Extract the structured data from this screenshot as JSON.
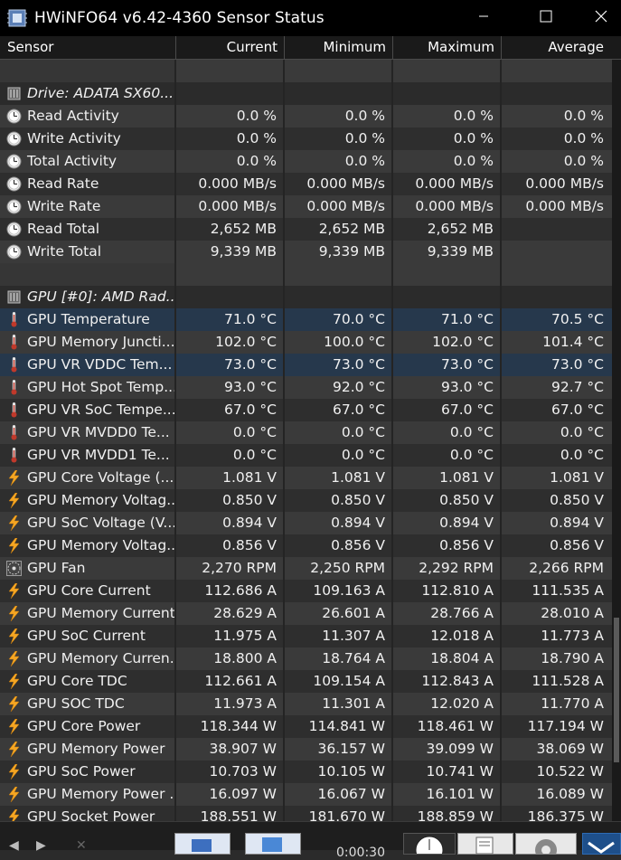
{
  "window": {
    "title": "HWiNFO64 v6.42-4360 Sensor Status",
    "minimize_glyph": "—",
    "maximize_glyph": "☐",
    "close_glyph": "✕"
  },
  "columns": {
    "sensor": "Sensor",
    "current": "Current",
    "minimum": "Minimum",
    "maximum": "Maximum",
    "average": "Average"
  },
  "rows": [
    {
      "type": "blank"
    },
    {
      "type": "group",
      "icon": "chip-icon",
      "name": "Drive: ADATA SX60..."
    },
    {
      "type": "data",
      "icon": "clock-icon",
      "name": "Read Activity",
      "current": "0.0 %",
      "min": "0.0 %",
      "max": "0.0 %",
      "avg": "0.0 %"
    },
    {
      "type": "data",
      "icon": "clock-icon",
      "name": "Write Activity",
      "current": "0.0 %",
      "min": "0.0 %",
      "max": "0.0 %",
      "avg": "0.0 %"
    },
    {
      "type": "data",
      "icon": "clock-icon",
      "name": "Total Activity",
      "current": "0.0 %",
      "min": "0.0 %",
      "max": "0.0 %",
      "avg": "0.0 %"
    },
    {
      "type": "data",
      "icon": "clock-icon",
      "name": "Read Rate",
      "current": "0.000 MB/s",
      "min": "0.000 MB/s",
      "max": "0.000 MB/s",
      "avg": "0.000 MB/s"
    },
    {
      "type": "data",
      "icon": "clock-icon",
      "name": "Write Rate",
      "current": "0.000 MB/s",
      "min": "0.000 MB/s",
      "max": "0.000 MB/s",
      "avg": "0.000 MB/s"
    },
    {
      "type": "data",
      "icon": "clock-icon",
      "name": "Read Total",
      "current": "2,652 MB",
      "min": "2,652 MB",
      "max": "2,652 MB",
      "avg": ""
    },
    {
      "type": "data",
      "icon": "clock-icon",
      "name": "Write Total",
      "current": "9,339 MB",
      "min": "9,339 MB",
      "max": "9,339 MB",
      "avg": ""
    },
    {
      "type": "blank"
    },
    {
      "type": "group",
      "icon": "chip-icon",
      "name": "GPU [#0]: AMD Rad..."
    },
    {
      "type": "data",
      "icon": "thermometer-icon",
      "name": "GPU Temperature",
      "current": "71.0 °C",
      "min": "70.0 °C",
      "max": "71.0 °C",
      "avg": "70.5 °C",
      "highlight": true
    },
    {
      "type": "data",
      "icon": "thermometer-icon",
      "name": "GPU Memory Juncti...",
      "current": "102.0 °C",
      "min": "100.0 °C",
      "max": "102.0 °C",
      "avg": "101.4 °C"
    },
    {
      "type": "data",
      "icon": "thermometer-icon",
      "name": "GPU VR VDDC Tem...",
      "current": "73.0 °C",
      "min": "73.0 °C",
      "max": "73.0 °C",
      "avg": "73.0 °C",
      "highlight": true
    },
    {
      "type": "data",
      "icon": "thermometer-icon",
      "name": "GPU Hot Spot Temp...",
      "current": "93.0 °C",
      "min": "92.0 °C",
      "max": "93.0 °C",
      "avg": "92.7 °C"
    },
    {
      "type": "data",
      "icon": "thermometer-icon",
      "name": "GPU VR SoC Tempe...",
      "current": "67.0 °C",
      "min": "67.0 °C",
      "max": "67.0 °C",
      "avg": "67.0 °C"
    },
    {
      "type": "data",
      "icon": "thermometer-icon",
      "name": "GPU VR MVDD0 Te...",
      "current": "0.0 °C",
      "min": "0.0 °C",
      "max": "0.0 °C",
      "avg": "0.0 °C"
    },
    {
      "type": "data",
      "icon": "thermometer-icon",
      "name": "GPU VR MVDD1 Te...",
      "current": "0.0 °C",
      "min": "0.0 °C",
      "max": "0.0 °C",
      "avg": "0.0 °C"
    },
    {
      "type": "data",
      "icon": "lightning-icon",
      "name": "GPU Core Voltage (...",
      "current": "1.081 V",
      "min": "1.081 V",
      "max": "1.081 V",
      "avg": "1.081 V"
    },
    {
      "type": "data",
      "icon": "lightning-icon",
      "name": "GPU Memory Voltag...",
      "current": "0.850 V",
      "min": "0.850 V",
      "max": "0.850 V",
      "avg": "0.850 V"
    },
    {
      "type": "data",
      "icon": "lightning-icon",
      "name": "GPU SoC Voltage (V...",
      "current": "0.894 V",
      "min": "0.894 V",
      "max": "0.894 V",
      "avg": "0.894 V"
    },
    {
      "type": "data",
      "icon": "lightning-icon",
      "name": "GPU Memory Voltag...",
      "current": "0.856 V",
      "min": "0.856 V",
      "max": "0.856 V",
      "avg": "0.856 V"
    },
    {
      "type": "data",
      "icon": "fan-icon",
      "name": "GPU Fan",
      "current": "2,270 RPM",
      "min": "2,250 RPM",
      "max": "2,292 RPM",
      "avg": "2,266 RPM"
    },
    {
      "type": "data",
      "icon": "lightning-icon",
      "name": "GPU Core Current",
      "current": "112.686 A",
      "min": "109.163 A",
      "max": "112.810 A",
      "avg": "111.535 A"
    },
    {
      "type": "data",
      "icon": "lightning-icon",
      "name": "GPU Memory Current",
      "current": "28.629 A",
      "min": "26.601 A",
      "max": "28.766 A",
      "avg": "28.010 A"
    },
    {
      "type": "data",
      "icon": "lightning-icon",
      "name": "GPU SoC Current",
      "current": "11.975 A",
      "min": "11.307 A",
      "max": "12.018 A",
      "avg": "11.773 A"
    },
    {
      "type": "data",
      "icon": "lightning-icon",
      "name": "GPU Memory Curren...",
      "current": "18.800 A",
      "min": "18.764 A",
      "max": "18.804 A",
      "avg": "18.790 A"
    },
    {
      "type": "data",
      "icon": "lightning-icon",
      "name": "GPU Core TDC",
      "current": "112.661 A",
      "min": "109.154 A",
      "max": "112.843 A",
      "avg": "111.528 A"
    },
    {
      "type": "data",
      "icon": "lightning-icon",
      "name": "GPU SOC TDC",
      "current": "11.973 A",
      "min": "11.301 A",
      "max": "12.020 A",
      "avg": "11.770 A"
    },
    {
      "type": "data",
      "icon": "lightning-icon",
      "name": "GPU Core Power",
      "current": "118.344 W",
      "min": "114.841 W",
      "max": "118.461 W",
      "avg": "117.194 W"
    },
    {
      "type": "data",
      "icon": "lightning-icon",
      "name": "GPU Memory Power",
      "current": "38.907 W",
      "min": "36.157 W",
      "max": "39.099 W",
      "avg": "38.069 W"
    },
    {
      "type": "data",
      "icon": "lightning-icon",
      "name": "GPU SoC Power",
      "current": "10.703 W",
      "min": "10.105 W",
      "max": "10.741 W",
      "avg": "10.522 W"
    },
    {
      "type": "data",
      "icon": "lightning-icon",
      "name": "GPU Memory Power ...",
      "current": "16.097 W",
      "min": "16.067 W",
      "max": "16.101 W",
      "avg": "16.089 W"
    },
    {
      "type": "data",
      "icon": "lightning-icon",
      "name": "GPU Socket Power",
      "current": "188.551 W",
      "min": "181.670 W",
      "max": "188.859 W",
      "avg": "186.375 W"
    }
  ],
  "toolbar": {
    "elapsed_time": "0:00:30"
  },
  "colors": {
    "row_even": "#3a3a3a",
    "row_odd": "#2e2e2e",
    "highlight": "#26384c",
    "thermometer": "#c0392b",
    "lightning": "#f5a623"
  }
}
